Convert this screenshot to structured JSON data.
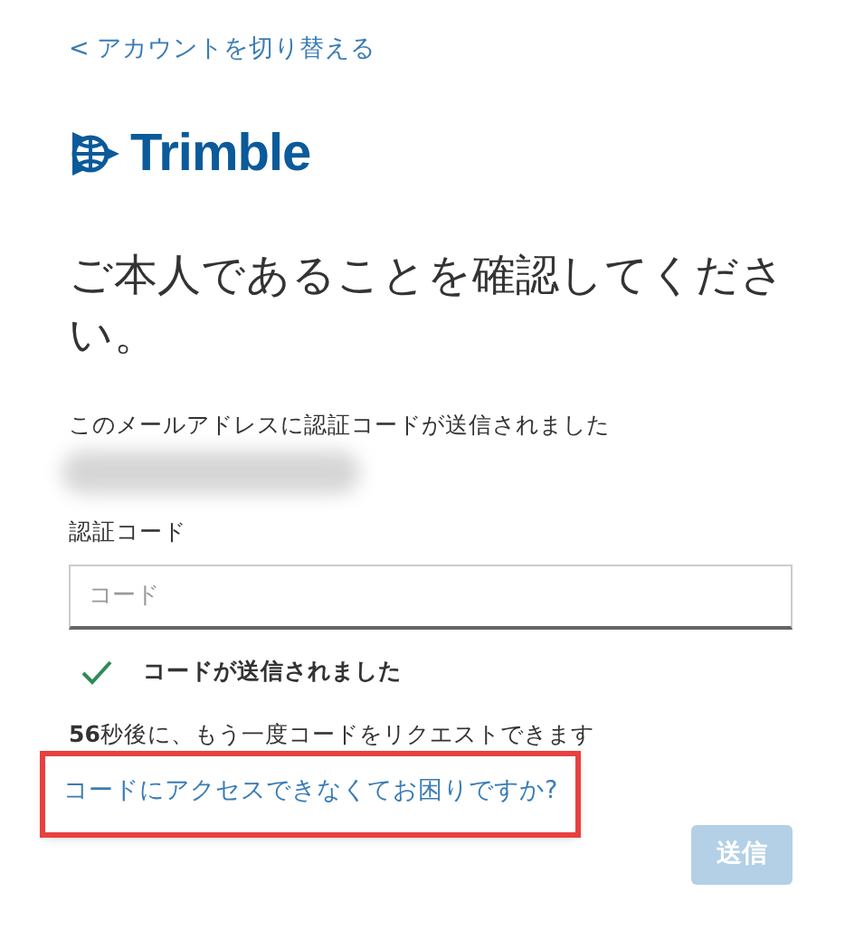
{
  "back_link": "< アカウントを切り替える",
  "logo": {
    "text": "Trimble"
  },
  "heading": "ご本人であることを確認してください。",
  "sent_notice": "このメールアドレスに認証コードが送信されました",
  "email": {
    "redacted": true
  },
  "code_field": {
    "label": "認証コード",
    "placeholder": "コード"
  },
  "status": {
    "text": "コードが送信されました",
    "success": true
  },
  "resend_notice": "**56**秒後に、もう一度コードをリクエストできます",
  "help_link": {
    "text": "コードにアクセスできなくてお困りですか?",
    "highlighted": true
  },
  "submit_button": {
    "label": "送信",
    "disabled": true
  }
}
